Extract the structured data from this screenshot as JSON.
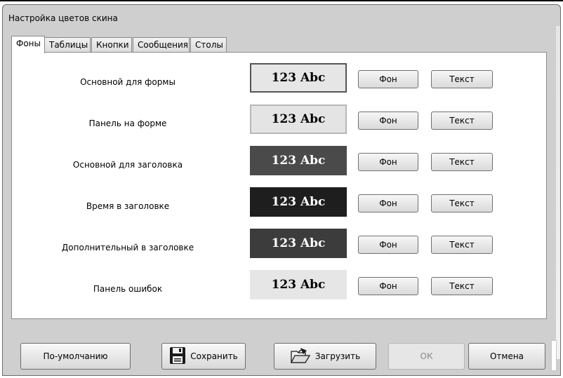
{
  "window": {
    "title": "Настройка цветов скина"
  },
  "tabs": [
    {
      "label": "Фоны",
      "active": true
    },
    {
      "label": "Таблицы",
      "active": false
    },
    {
      "label": "Кнопки",
      "active": false
    },
    {
      "label": "Сообщения",
      "active": false
    },
    {
      "label": "Столы",
      "active": false
    }
  ],
  "rows": [
    {
      "label": "Основной для формы",
      "sample": "123 Abc",
      "bg": "#e6e6e6",
      "fg": "#000000",
      "border": "#555555",
      "fon_label": "Фон",
      "text_label": "Текст"
    },
    {
      "label": "Панель на форме",
      "sample": "123 Abc",
      "bg": "#e4e4e4",
      "fg": "#000000",
      "border": "#b8b8b8",
      "fon_label": "Фон",
      "text_label": "Текст"
    },
    {
      "label": "Основной для заголовка",
      "sample": "123 Abc",
      "bg": "#4a4a4a",
      "fg": "#ffffff",
      "border": "#4a4a4a",
      "fon_label": "Фон",
      "text_label": "Текст"
    },
    {
      "label": "Время в заголовке",
      "sample": "123 Abc",
      "bg": "#1e1e1e",
      "fg": "#ffffff",
      "border": "#1e1e1e",
      "fon_label": "Фон",
      "text_label": "Текст"
    },
    {
      "label": "Дополнительный в заголовке",
      "sample": "123 Abc",
      "bg": "#3c3c3c",
      "fg": "#ffffff",
      "border": "#3c3c3c",
      "fon_label": "Фон",
      "text_label": "Текст"
    },
    {
      "label": "Панель ошибок",
      "sample": "123 Abc",
      "bg": "#e6e6e6",
      "fg": "#000000",
      "border": "#e6e6e6",
      "fon_label": "Фон",
      "text_label": "Текст"
    }
  ],
  "footer": {
    "default_label": "По-умолчанию",
    "save_label": "Сохранить",
    "load_label": "Загрузить",
    "ok_label": "ОК",
    "ok_enabled": false,
    "cancel_label": "Отмена"
  },
  "icons": {
    "save": "floppy-disk-icon",
    "load": "open-folder-icon"
  }
}
